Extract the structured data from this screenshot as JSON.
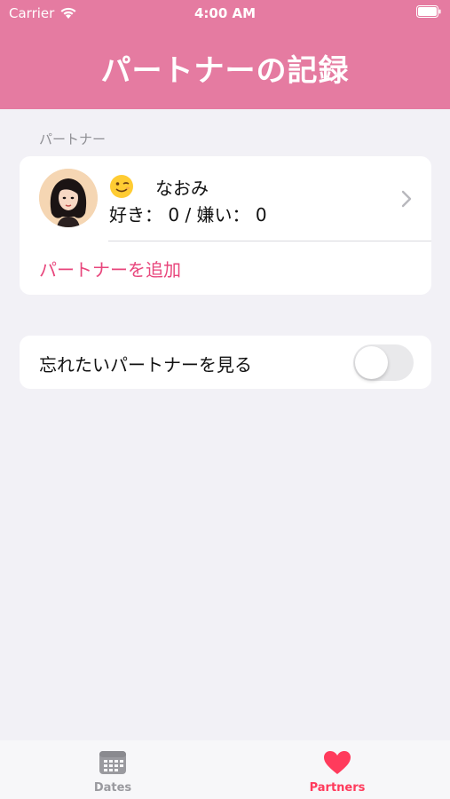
{
  "status_bar": {
    "carrier": "Carrier",
    "time": "4:00 AM"
  },
  "header": {
    "title": "パートナーの記録",
    "background_color": "#e57ba1"
  },
  "partners_section": {
    "label": "パートナー",
    "partners": [
      {
        "emoji": "winking-face-icon",
        "name": "なおみ",
        "likes_text": "好き： 0 / 嫌い： 0"
      }
    ],
    "add_label": "パートナーを追加"
  },
  "forget_toggle": {
    "label": "忘れたいパートナーを見る",
    "on": false
  },
  "tabbar": {
    "tabs": [
      {
        "label": "Dates",
        "icon": "calendar-icon",
        "selected": false
      },
      {
        "label": "Partners",
        "icon": "heart-icon",
        "selected": true
      }
    ],
    "accent_color": "#ff3b5c"
  }
}
